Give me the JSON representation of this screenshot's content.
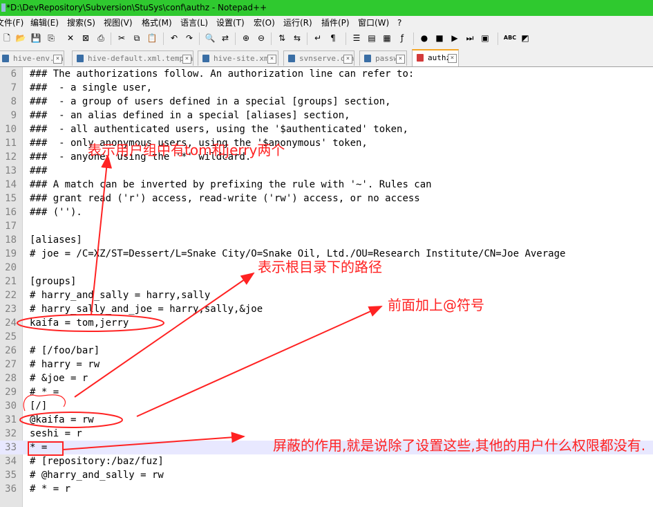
{
  "window": {
    "title": "*D:\\DevRepository\\Subversion\\StuSys\\conf\\authz - Notepad++"
  },
  "menu": [
    "文件(F)",
    "编辑(E)",
    "搜索(S)",
    "视图(V)",
    "格式(M)",
    "语言(L)",
    "设置(T)",
    "宏(O)",
    "运行(R)",
    "插件(P)",
    "窗口(W)",
    "?"
  ],
  "toolbar": [
    {
      "name": "new-icon",
      "glyph": "🗋"
    },
    {
      "name": "open-icon",
      "glyph": "📂"
    },
    {
      "name": "save-icon",
      "glyph": "💾"
    },
    {
      "name": "save-all-icon",
      "glyph": "⎘"
    },
    {
      "name": "close-icon",
      "glyph": "✕"
    },
    {
      "name": "close-all-icon",
      "glyph": "⊠"
    },
    {
      "name": "print-icon",
      "glyph": "⎙"
    },
    {
      "name": "cut-icon",
      "glyph": "✂"
    },
    {
      "name": "copy-icon",
      "glyph": "⧉"
    },
    {
      "name": "paste-icon",
      "glyph": "📋"
    },
    {
      "name": "undo-icon",
      "glyph": "↶"
    },
    {
      "name": "redo-icon",
      "glyph": "↷"
    },
    {
      "name": "find-icon",
      "glyph": "🔍"
    },
    {
      "name": "replace-icon",
      "glyph": "⇄"
    },
    {
      "name": "zoom-in-icon",
      "glyph": "⊕"
    },
    {
      "name": "zoom-out-icon",
      "glyph": "⊖"
    },
    {
      "name": "sync-vertical-icon",
      "glyph": "⇅"
    },
    {
      "name": "sync-horizontal-icon",
      "glyph": "⇆"
    },
    {
      "name": "word-wrap-icon",
      "glyph": "↵"
    },
    {
      "name": "show-all-chars-icon",
      "glyph": "¶"
    },
    {
      "name": "indent-guide-icon",
      "glyph": "☰"
    },
    {
      "name": "user-language-icon",
      "glyph": "▤"
    },
    {
      "name": "doc-map-icon",
      "glyph": "▦"
    },
    {
      "name": "function-list-icon",
      "glyph": "ƒ"
    },
    {
      "name": "record-macro-icon",
      "glyph": "●"
    },
    {
      "name": "stop-macro-icon",
      "glyph": "■"
    },
    {
      "name": "play-macro-icon",
      "glyph": "▶"
    },
    {
      "name": "play-multiple-icon",
      "glyph": "⏭"
    },
    {
      "name": "save-macro-icon",
      "glyph": "▣"
    },
    {
      "name": "spell-check-icon",
      "glyph": "ABC"
    },
    {
      "name": "plugin-icon",
      "glyph": "◩"
    }
  ],
  "tabs": [
    {
      "label": "hive-env.sh",
      "active": false
    },
    {
      "label": "hive-default.xml.template",
      "active": false
    },
    {
      "label": "hive-site.xml",
      "active": false
    },
    {
      "label": "svnserve.conf",
      "active": false
    },
    {
      "label": "passwd",
      "active": false
    },
    {
      "label": "authz",
      "active": true
    }
  ],
  "editor": {
    "current_line": 33,
    "lines": [
      {
        "n": "6",
        "text": "### The authorizations follow. An authorization line can refer to:"
      },
      {
        "n": "7",
        "text": "###  - a single user,"
      },
      {
        "n": "8",
        "text": "###  - a group of users defined in a special [groups] section,"
      },
      {
        "n": "9",
        "text": "###  - an alias defined in a special [aliases] section,"
      },
      {
        "n": "10",
        "text": "###  - all authenticated users, using the '$authenticated' token,"
      },
      {
        "n": "11",
        "text": "###  - only anonymous users, using the '$anonymous' token,"
      },
      {
        "n": "12",
        "text": "###  - anyone, using the '*' wildcard."
      },
      {
        "n": "13",
        "text": "###"
      },
      {
        "n": "14",
        "text": "### A match can be inverted by prefixing the rule with '~'. Rules can"
      },
      {
        "n": "15",
        "text": "### grant read ('r') access, read-write ('rw') access, or no access"
      },
      {
        "n": "16",
        "text": "### ('')."
      },
      {
        "n": "17",
        "text": ""
      },
      {
        "n": "18",
        "text": "[aliases]"
      },
      {
        "n": "19",
        "text": "# joe = /C=XZ/ST=Dessert/L=Snake City/O=Snake Oil, Ltd./OU=Research Institute/CN=Joe Average"
      },
      {
        "n": "20",
        "text": ""
      },
      {
        "n": "21",
        "text": "[groups]"
      },
      {
        "n": "22",
        "text": "# harry_and_sally = harry,sally"
      },
      {
        "n": "23",
        "text": "# harry_sally_and_joe = harry,sally,&joe"
      },
      {
        "n": "24",
        "text": "kaifa = tom,jerry"
      },
      {
        "n": "25",
        "text": ""
      },
      {
        "n": "26",
        "text": "# [/foo/bar]"
      },
      {
        "n": "27",
        "text": "# harry = rw"
      },
      {
        "n": "28",
        "text": "# &joe = r"
      },
      {
        "n": "29",
        "text": "# * ="
      },
      {
        "n": "30",
        "text": "[/]"
      },
      {
        "n": "31",
        "text": "@kaifa = rw"
      },
      {
        "n": "32",
        "text": "seshi = r"
      },
      {
        "n": "33",
        "text": "* ="
      },
      {
        "n": "34",
        "text": "# [repository:/baz/fuz]"
      },
      {
        "n": "35",
        "text": "# @harry_and_sally = rw"
      },
      {
        "n": "36",
        "text": "# * = r"
      }
    ]
  },
  "annotations": {
    "group_note": "表示用户组中有tom和jerry两个",
    "root_path_note": "表示根目录下的路径",
    "at_sign_note": "前面加上@符号",
    "mask_note": "屏蔽的作用,就是说除了设置这些,其他的用户什么权限都没有.",
    "color": "#ff2222"
  }
}
